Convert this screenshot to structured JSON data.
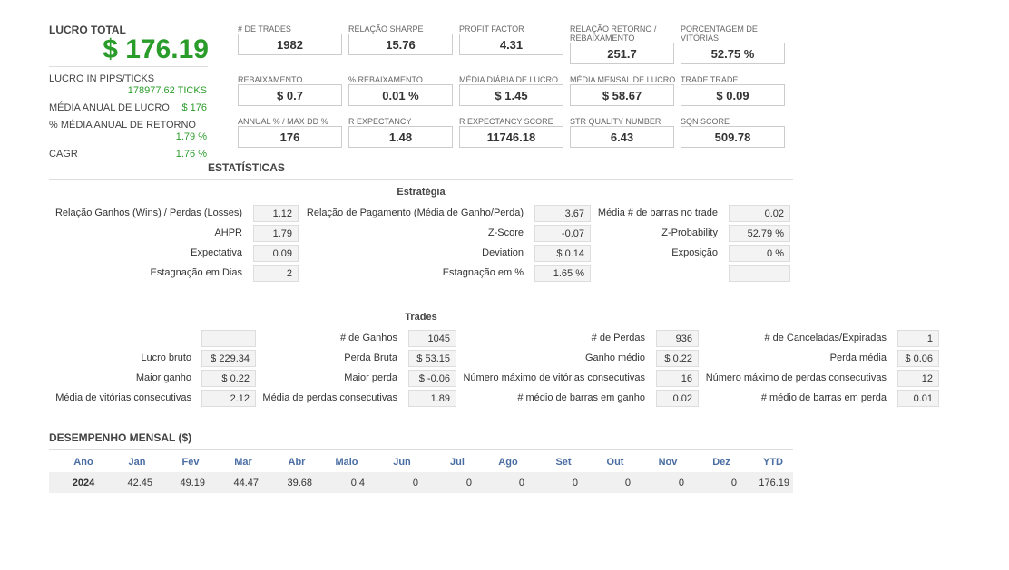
{
  "summary": {
    "total_profit_label": "LUCRO TOTAL",
    "total_profit_value": "$ 176.19",
    "rows": [
      {
        "label": "LUCRO IN PIPS/TICKS",
        "value": "178977.62 TICKS"
      },
      {
        "label": "MÉDIA ANUAL DE LUCRO",
        "value": "$ 176"
      },
      {
        "label": "% MÉDIA ANUAL DE RETORNO",
        "value": "1.79 %"
      },
      {
        "label": "CAGR",
        "value": "1.76 %"
      }
    ]
  },
  "metrics": [
    {
      "label": "# DE TRADES",
      "value": "1982"
    },
    {
      "label": "RELAÇÃO SHARPE",
      "value": "15.76"
    },
    {
      "label": "PROFIT FACTOR",
      "value": "4.31"
    },
    {
      "label": "RELAÇÃO RETORNO / REBAIXAMENTO",
      "value": "251.7"
    },
    {
      "label": "PORCENTAGEM DE VITÓRIAS",
      "value": "52.75 %"
    },
    {
      "label": "REBAIXAMENTO",
      "value": "$ 0.7"
    },
    {
      "label": "% REBAIXAMENTO",
      "value": "0.01 %"
    },
    {
      "label": "MÉDIA DIÁRIA DE LUCRO",
      "value": "$ 1.45"
    },
    {
      "label": "MÉDIA MENSAL DE LUCRO",
      "value": "$ 58.67"
    },
    {
      "label": "TRADE TRADE",
      "value": "$ 0.09"
    },
    {
      "label": "ANNUAL % / MAX DD %",
      "value": "176"
    },
    {
      "label": "R EXPECTANCY",
      "value": "1.48"
    },
    {
      "label": "R EXPECTANCY SCORE",
      "value": "11746.18"
    },
    {
      "label": "STR QUALITY NUMBER",
      "value": "6.43"
    },
    {
      "label": "SQN SCORE",
      "value": "509.78"
    }
  ],
  "stats_title": "ESTATÍSTICAS",
  "strategy": {
    "title": "Estratégia",
    "col1": [
      {
        "label": "Relação Ganhos (Wins) / Perdas (Losses)",
        "value": "1.12"
      },
      {
        "label": "AHPR",
        "value": "1.79"
      },
      {
        "label": "Expectativa",
        "value": "0.09"
      },
      {
        "label": "Estagnação em Dias",
        "value": "2"
      }
    ],
    "col2": [
      {
        "label": "Relação de Pagamento (Média de Ganho/Perda)",
        "value": "3.67"
      },
      {
        "label": "Z-Score",
        "value": "-0.07"
      },
      {
        "label": "Deviation",
        "value": "$ 0.14"
      },
      {
        "label": "Estagnação em %",
        "value": "1.65 %"
      }
    ],
    "col3": [
      {
        "label": "Média # de barras no trade",
        "value": "0.02"
      },
      {
        "label": "Z-Probability",
        "value": "52.79 %"
      },
      {
        "label": "Exposição",
        "value": "0 %"
      },
      {
        "label": "",
        "value": ""
      }
    ]
  },
  "trades": {
    "title": "Trades",
    "col1": [
      {
        "label": "",
        "value": ""
      },
      {
        "label": "Lucro bruto",
        "value": "$ 229.34"
      },
      {
        "label": "Maior ganho",
        "value": "$ 0.22"
      },
      {
        "label": "Média de vitórias consecutivas",
        "value": "2.12"
      }
    ],
    "col2": [
      {
        "label": "# de Ganhos",
        "value": "1045"
      },
      {
        "label": "Perda Bruta",
        "value": "$ 53.15"
      },
      {
        "label": "Maior perda",
        "value": "$ -0.06"
      },
      {
        "label": "Média de perdas consecutivas",
        "value": "1.89"
      }
    ],
    "col3": [
      {
        "label": "# de Perdas",
        "value": "936"
      },
      {
        "label": "Ganho médio",
        "value": "$ 0.22"
      },
      {
        "label": "Número máximo de vitórias consecutivas",
        "value": "16"
      },
      {
        "label": "# médio de barras em ganho",
        "value": "0.02"
      }
    ],
    "col4": [
      {
        "label": "# de Canceladas/Expiradas",
        "value": "1"
      },
      {
        "label": "Perda média",
        "value": "$ 0.06"
      },
      {
        "label": "Número máximo de perdas consecutivas",
        "value": "12"
      },
      {
        "label": "# médio de barras em perda",
        "value": "0.01"
      }
    ]
  },
  "monthly": {
    "title": "DESEMPENHO MENSAL ($)",
    "headers": [
      "Ano",
      "Jan",
      "Fev",
      "Mar",
      "Abr",
      "Maio",
      "Jun",
      "Jul",
      "Ago",
      "Set",
      "Out",
      "Nov",
      "Dez",
      "YTD"
    ],
    "rows": [
      {
        "cells": [
          "2024",
          "42.45",
          "49.19",
          "44.47",
          "39.68",
          "0.4",
          "0",
          "0",
          "0",
          "0",
          "0",
          "0",
          "0",
          "176.19"
        ]
      }
    ]
  }
}
